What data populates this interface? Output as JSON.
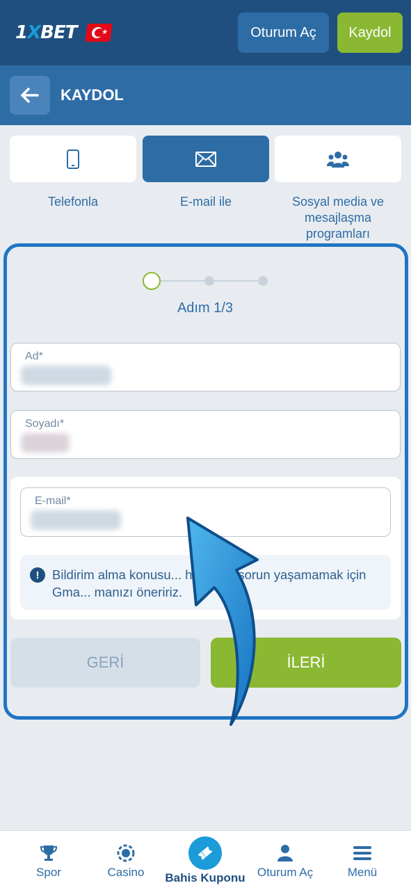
{
  "header": {
    "logo_text": "1XBET",
    "logo_prefix": "1",
    "logo_x": "X",
    "logo_suffix": "BET",
    "login_button": "Oturum Aç",
    "register_button": "Kaydol"
  },
  "subheader": {
    "title": "KAYDOL"
  },
  "methods": [
    {
      "label": "Telefonla",
      "icon": "phone-icon",
      "active": false
    },
    {
      "label": "E-mail ile",
      "icon": "envelope-icon",
      "active": true
    },
    {
      "label": "Sosyal media ve mesajlaşma programları",
      "icon": "users-icon",
      "active": false
    }
  ],
  "stepper": {
    "label": "Adım 1/3",
    "current_step": 1,
    "total_steps": 3
  },
  "form": {
    "first_name_label": "Ad*",
    "last_name_label": "Soyadı*",
    "email_label": "E-mail*"
  },
  "info": {
    "text": "Bildirim alma konusu... hangi bir sorun yaşamamak için Gma... manızı öneririz."
  },
  "buttons": {
    "back": "GERİ",
    "next": "İLERİ"
  },
  "bottom_nav": [
    {
      "label": "Spor",
      "icon": "trophy-icon"
    },
    {
      "label": "Casino",
      "icon": "casino-chip-icon"
    },
    {
      "label": "Bahis Kuponu",
      "icon": "ticket-icon"
    },
    {
      "label": "Oturum Aç",
      "icon": "user-icon"
    },
    {
      "label": "Menü",
      "icon": "menu-icon"
    }
  ],
  "colors": {
    "header_bg": "#1f4f7f",
    "subheader_bg": "#2e6ca6",
    "accent_green": "#8ab833",
    "accent_blue": "#1b9bd8",
    "page_bg": "#e8ecf0"
  }
}
